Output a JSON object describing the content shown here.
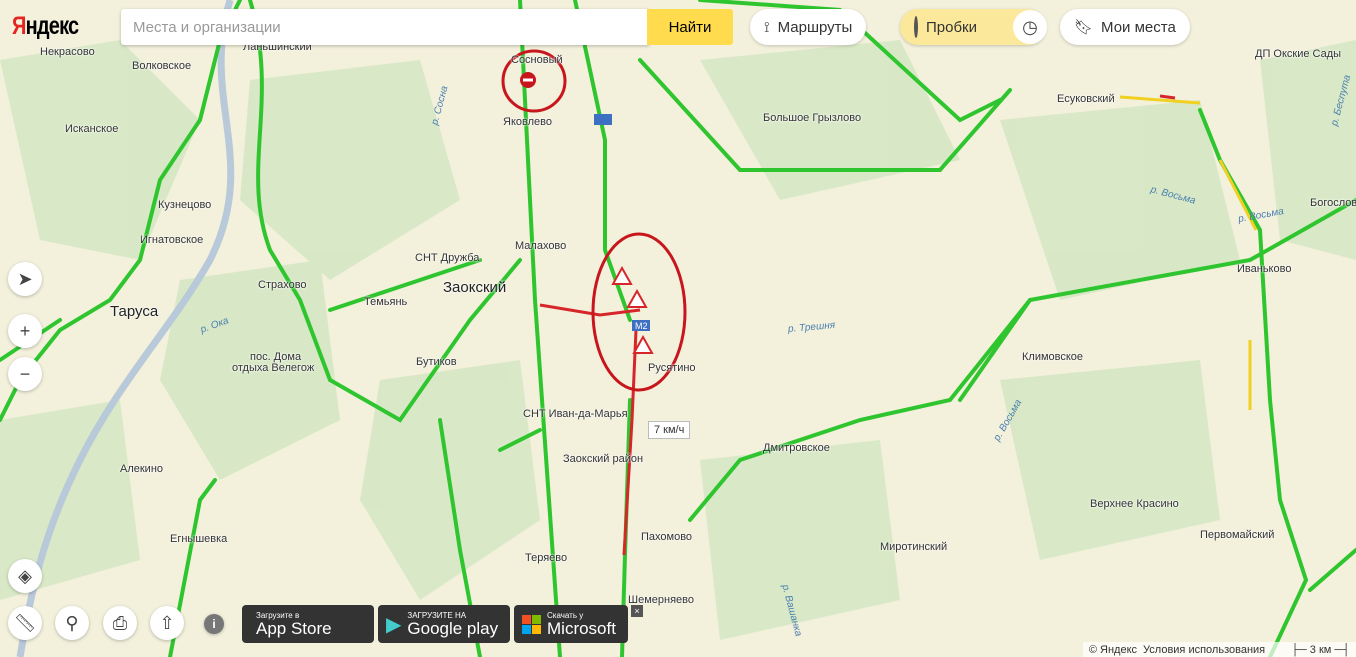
{
  "header": {
    "logo": "Яндекс",
    "search_placeholder": "Места и организации",
    "search_button": "Найти",
    "routes_label": "Маршруты",
    "traffic_label": "Пробки",
    "my_places_label": "Мои места"
  },
  "map": {
    "places": [
      "Некрасово",
      "Волковское",
      "Исканское",
      "Кузнецово",
      "Игнатовское",
      "Таруса",
      "Страхово",
      "Темьянь",
      "СНТ Дружба",
      "Малахово",
      "Заокский",
      "Бутиков",
      "пос. Дома",
      "отдыха Велегож",
      "СНТ Иван-да-Марья",
      "Заокский район",
      "Алекино",
      "Егнышевка",
      "Теряево",
      "Пахомово",
      "Шемерняево",
      "Русятино",
      "Дмитровское",
      "Миротинский",
      "Верхнее Красино",
      "Первомайский",
      "Климовское",
      "Иваньково",
      "Есуковский",
      "ДП Окские Сады",
      "Большое Грызлово",
      "Яковлево",
      "Сосновый",
      "Ланьшинский",
      "Богослово"
    ],
    "rivers": [
      "р. Сосна",
      "р. Ока",
      "р. Трешня",
      "р. Восьма",
      "р. Восьма",
      "р. Вашанка",
      "р. Беспута",
      "р. Восьма"
    ],
    "road_shield": "М2",
    "speed_label": "7 км/ч",
    "colors": {
      "free": "#2fc52f",
      "slow": "#f0d020",
      "jam": "#d6262a",
      "annotation": "#c8161d"
    }
  },
  "controls": {
    "zoom_in": "+",
    "zoom_out": "−",
    "info": "i"
  },
  "stores": [
    {
      "small": "Загрузите в",
      "big": "App Store"
    },
    {
      "small": "ЗАГРУЗИТЕ НА",
      "big": "Google play"
    },
    {
      "small": "Скачать у",
      "big": "Microsoft"
    }
  ],
  "footer": {
    "copyright": "© Яндекс",
    "terms": "Условия использования",
    "scale": "3 км"
  }
}
